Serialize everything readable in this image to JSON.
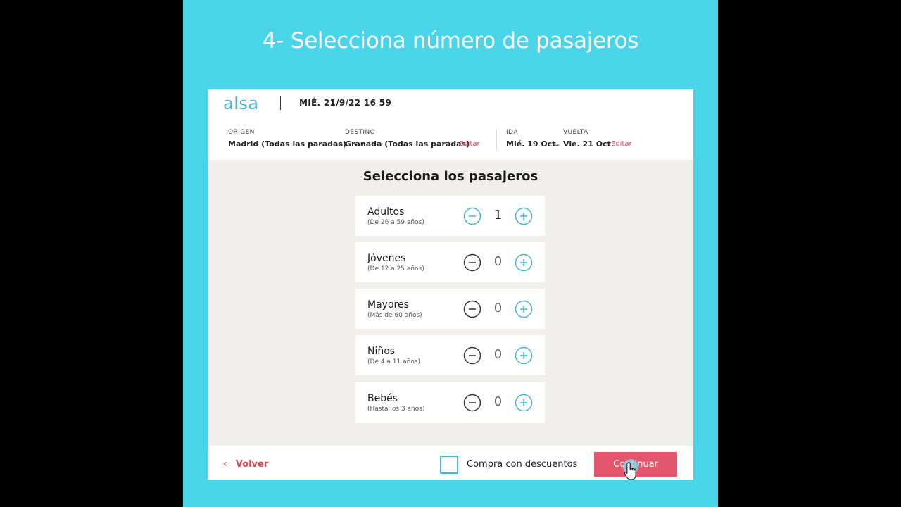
{
  "banner": {
    "title": "4- Selecciona número de pasajeros"
  },
  "header": {
    "logo": "alsa",
    "datetime": "MIÉ.  21/9/22  16 59",
    "origin_label": "ORIGEN",
    "origin_value": "Madrid (Todas las paradas)",
    "separator": "--",
    "destination_label": "DESTINO",
    "destination_value": "Granada (Todas las paradas)",
    "edit_route": "Editar",
    "ida_label": "IDA",
    "ida_value": "Mié. 19 Oct.",
    "vuelta_label": "VUELTA",
    "vuelta_value": "Vie. 21 Oct.",
    "edit_dates": "Editar"
  },
  "main": {
    "title": "Selecciona los pasajeros",
    "passengers": [
      {
        "name": "Adultos",
        "range": "(De 26 a 59 años)",
        "count": "1"
      },
      {
        "name": "Jóvenes",
        "range": "(De 12 a 25 años)",
        "count": "0"
      },
      {
        "name": "Mayores",
        "range": "(Más de 60 años)",
        "count": "0"
      },
      {
        "name": "Niños",
        "range": "(De 4 a 11 años)",
        "count": "0"
      },
      {
        "name": "Bebés",
        "range": "(Hasta los 3 años)",
        "count": "0"
      }
    ]
  },
  "footer": {
    "back_label": "Volver",
    "back_icon": "chevron-left-icon",
    "discount_label": "Compra con descuentos",
    "discount_checked": false,
    "continue_label": "Continuar"
  },
  "colors": {
    "background": "#4ad4e8",
    "brand": "#4ab3cf",
    "accent": "#d94a5a",
    "continue_button": "#e3566b"
  },
  "icons": [
    "minus-circle-icon",
    "plus-circle-icon",
    "hand-pointer-icon"
  ]
}
